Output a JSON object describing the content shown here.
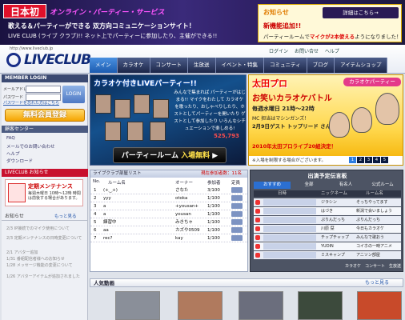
{
  "header": {
    "badge": "日本初",
    "subtitle": "オンライン・パーティー・サービス",
    "line1": "歌える＆パーティーができる 双方向コミュニケーションサイト！",
    "line2": "LIVE CLUB (ライブ クラブ)!! ネット上でパーティーに参加したり、主催ができる!!"
  },
  "news": {
    "title": "お知らせ",
    "button": "詳細はこちら→",
    "headline": "新機能追加!!",
    "body_pre": "パーティールームで",
    "body_em": "マイクが2本使える",
    "body_post": "ようになりました！"
  },
  "site": {
    "url": "http://www.liveclub.jp",
    "logo": "LIVECLUB",
    "top_links": [
      "ログイン",
      "お問い合せ",
      "ヘルプ"
    ]
  },
  "nav": [
    "メイン",
    "カラオケ",
    "コンサート",
    "生放送",
    "イベント・特集",
    "コミュニティ",
    "ブログ",
    "アイテムショップ"
  ],
  "sidebar": {
    "login_header": "MEMBER LOGIN",
    "email_label": "メールアドレス",
    "password_label": "パスワード",
    "login_button": "LOGIN",
    "forgot": "パスワードを忘れた方はこちら",
    "register": "無料会員登録",
    "support_header": "顧客センター",
    "support_items": [
      "FAQ",
      "メールでのお問い合わせ",
      "ヘルプ",
      "ダウンロード"
    ],
    "notice_header": "LIVECLUB お知らせ",
    "maint_title": "定期メンテナンス",
    "maint_text": "毎週木曜日 10時〜12時 時間は前後する場合があります。",
    "oshirase": "お知らせ",
    "more": "もっと見る",
    "news": [
      "2/3 IP接続でのマイク使用について",
      "2/3 定期メンテナンスの日時変更について",
      "2/1 アバター追加",
      "1/31 番組配信者様へのお知らせ",
      "1/28 メッセージ機能の変更について",
      "1/26 アバターアイテムが追加されました"
    ]
  },
  "banner1": {
    "title": "カラオケ付きLIVEパーティー!!",
    "copy": "みんなで集まれば パーティーがはじまる!! マイクをわたして カラオケを歌ったり、おしゃべりしたり、ホストとしてパーティーを開いたり ゲストとして参加したり いろんなシチュエーションで楽しめる!",
    "count": "525,793",
    "cta_pre": "パーティールーム",
    "cta_em": "入場無料"
  },
  "banner2": {
    "name": "太田プロ",
    "tag": "カラオケパーティー",
    "battle": "お笑いカラオケバトル",
    "time": "毎週水曜日 21時〜22時",
    "mc": "MC 担当はマシンガンズ！",
    "guest": "2月9日ゲスト トップリード さん",
    "year": "2010年太田プロライブ20組決定！",
    "foot": "※入場を制限する場合がございます。"
  },
  "pager": [
    "1",
    "2",
    "3",
    "4",
    "5"
  ],
  "rooms": {
    "header": "ライブクラブ部屋リスト",
    "open_label": "現在参加者数：11名",
    "columns": [
      "No.",
      "ルーム名",
      "オーナー",
      "参加者",
      "定員"
    ],
    "rows": [
      {
        "no": "1",
        "name": "(+‿+)",
        "owner": "さなた",
        "count": "3/100"
      },
      {
        "no": "2",
        "name": "yyy",
        "owner": "otoka",
        "count": "1/100"
      },
      {
        "no": "3",
        "name": "a",
        "owner": "+yousan+",
        "count": "1/100"
      },
      {
        "no": "4",
        "name": "a",
        "owner": "yousan",
        "count": "1/100"
      },
      {
        "no": "5",
        "name": "練習中",
        "owner": "みきちゃ",
        "count": "1/100"
      },
      {
        "no": "6",
        "name": "aa",
        "owner": "カズや0509",
        "count": "1/100"
      },
      {
        "no": "7",
        "name": "rec?",
        "owner": "kay",
        "count": "1/100"
      }
    ]
  },
  "schedule": {
    "title": "出演予定伝言板",
    "tabs": [
      "おすすめ",
      "全部",
      "有名人",
      "公式ルーム"
    ],
    "columns": [
      "日時",
      "ニックネーム",
      "ルーム名"
    ],
    "rows": [
      {
        "date": "",
        "nick": "ジラシン",
        "room": "そっちやってます"
      },
      {
        "date": "",
        "nick": "はづき",
        "room": "新潟で会いましょう"
      },
      {
        "date": "",
        "nick": "ぷりんだっち",
        "room": "ぷりんだっち"
      },
      {
        "date": "",
        "nick": "川原 栞",
        "room": "今日もカラオケ"
      },
      {
        "date": "",
        "nick": "チップチャップ",
        "room": "みんなで歌おう"
      },
      {
        "date": "",
        "nick": "YUDIN",
        "room": "コイホの一時アニメ"
      },
      {
        "date": "",
        "nick": "ミスキャンプ",
        "room": "アニソン部屋"
      }
    ],
    "foot": "カラオケ　コンサート　生放送"
  },
  "videos": {
    "header": "人気動画",
    "more": "もっと見る"
  },
  "colors": {
    "nav_dark": "#1c2648",
    "accent_blue": "#2c7ce0",
    "register_orange": "#f5a400",
    "alert_red": "#c8102e"
  }
}
